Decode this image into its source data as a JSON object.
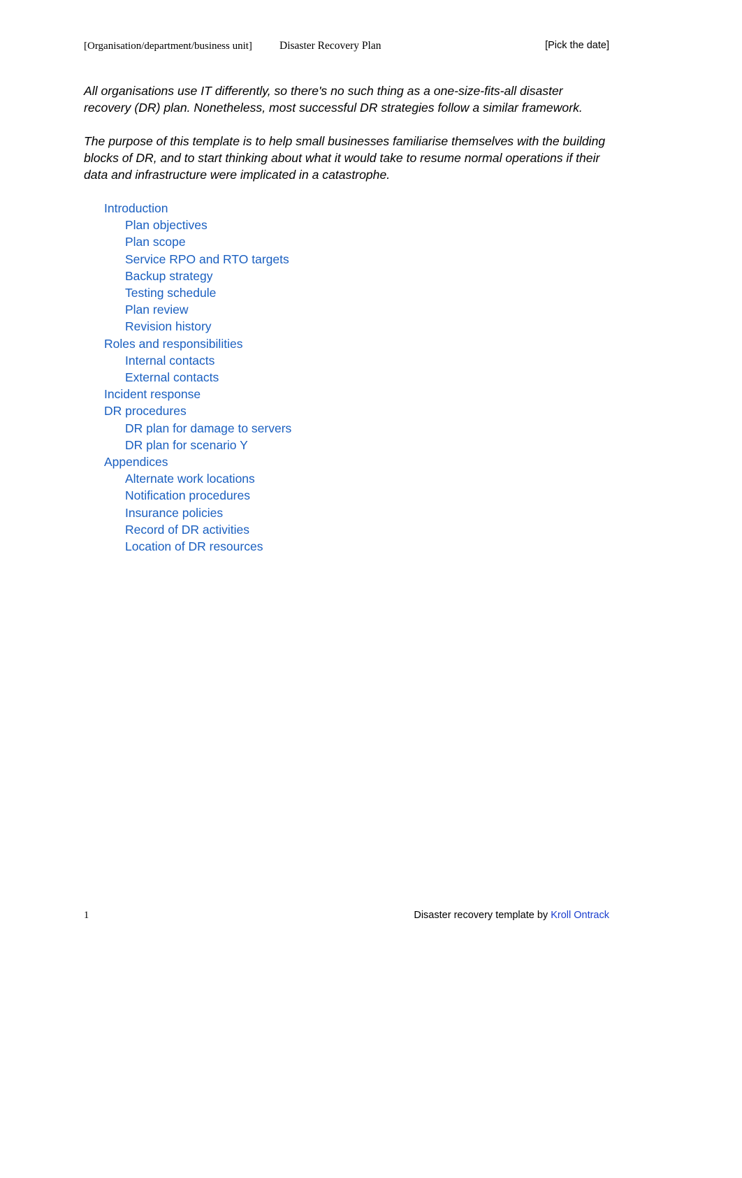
{
  "header": {
    "left": "[Organisation/department/business unit]",
    "center": "Disaster Recovery Plan",
    "right": "[Pick the date]"
  },
  "intro": {
    "paragraph_1": "All organisations use IT differently, so there's no such thing as a one-size-fits-all disaster recovery (DR) plan. Nonetheless, most successful DR strategies follow a similar framework.",
    "paragraph_2": "The purpose of this template is to help small businesses familiarise themselves with the building blocks of DR, and to start thinking about what it would take to resume normal operations if their data and infrastructure were implicated in a catastrophe."
  },
  "toc": {
    "link_color": "#1a5fc0",
    "items": [
      {
        "label": "Introduction",
        "level": 1
      },
      {
        "label": "Plan objectives",
        "level": 2
      },
      {
        "label": "Plan scope",
        "level": 2
      },
      {
        "label": "Service RPO and RTO targets",
        "level": 2
      },
      {
        "label": "Backup strategy",
        "level": 2
      },
      {
        "label": "Testing schedule",
        "level": 2
      },
      {
        "label": "Plan review",
        "level": 2
      },
      {
        "label": "Revision history",
        "level": 2
      },
      {
        "label": "Roles and responsibilities",
        "level": 1
      },
      {
        "label": "Internal contacts",
        "level": 2
      },
      {
        "label": "External contacts",
        "level": 2
      },
      {
        "label": "Incident response",
        "level": 1
      },
      {
        "label": "DR procedures",
        "level": 1
      },
      {
        "label": "DR plan for damage to servers",
        "level": 2
      },
      {
        "label": "DR plan for scenario Y",
        "level": 2
      },
      {
        "label": "Appendices",
        "level": 1
      },
      {
        "label": "Alternate work locations",
        "level": 2
      },
      {
        "label": "Notification procedures",
        "level": 2
      },
      {
        "label": "Insurance policies",
        "level": 2
      },
      {
        "label": "Record of DR activities",
        "level": 2
      },
      {
        "label": "Location of DR resources",
        "level": 2
      }
    ]
  },
  "footer": {
    "page_number": "1",
    "credit_text": "Disaster recovery template by ",
    "credit_link": "Kroll Ontrack",
    "link_color": "#1a3ecf"
  }
}
